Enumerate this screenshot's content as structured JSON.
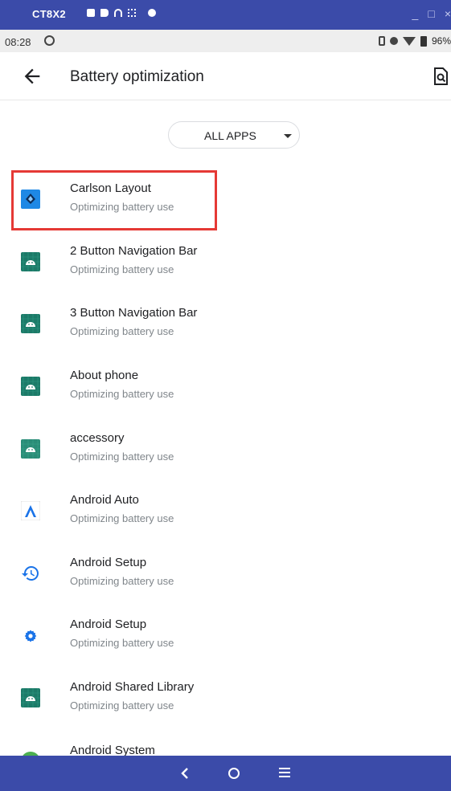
{
  "window": {
    "title": "CT8X2",
    "controls": [
      "_",
      "□",
      "×"
    ]
  },
  "status_bar": {
    "time": "08:28",
    "battery": "96%"
  },
  "app_bar": {
    "title": "Battery optimization"
  },
  "filter": {
    "label": "ALL APPS"
  },
  "apps": [
    {
      "name": "Carlson Layout",
      "status": "Optimizing battery use",
      "icon": "carlson-layout-icon",
      "color": "#1e88e5"
    },
    {
      "name": "2 Button Navigation Bar",
      "status": "Optimizing battery use",
      "icon": "android-robot-icon",
      "color": "#1c7a68"
    },
    {
      "name": "3 Button Navigation Bar",
      "status": "Optimizing battery use",
      "icon": "android-robot-icon",
      "color": "#1c7a68"
    },
    {
      "name": "About phone",
      "status": "Optimizing battery use",
      "icon": "android-robot-icon",
      "color": "#1c7a68"
    },
    {
      "name": "accessory",
      "status": "Optimizing battery use",
      "icon": "android-robot-icon",
      "color": "#2a8c77"
    },
    {
      "name": "Android Auto",
      "status": "Optimizing battery use",
      "icon": "android-auto-icon",
      "color": "#1a73e8"
    },
    {
      "name": "Android Setup",
      "status": "Optimizing battery use",
      "icon": "restore-history-icon",
      "color": "#1a73e8"
    },
    {
      "name": "Android Setup",
      "status": "Optimizing battery use",
      "icon": "gear-icon",
      "color": "#1a73e8"
    },
    {
      "name": "Android Shared Library",
      "status": "Optimizing battery use",
      "icon": "android-robot-icon",
      "color": "#1c7a68"
    },
    {
      "name": "Android System",
      "status": "",
      "icon": "android-system-icon",
      "color": "#4caf50"
    }
  ],
  "colors": {
    "chrome_bar": "#3b4ba9",
    "highlight": "#e53935"
  }
}
